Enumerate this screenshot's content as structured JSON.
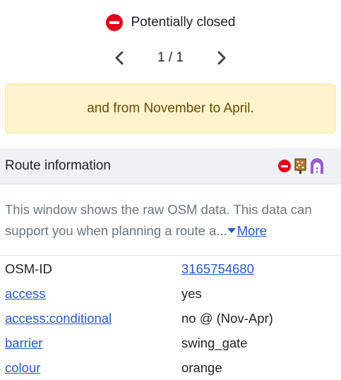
{
  "status": {
    "label": "Potentially closed",
    "icon": "no-entry-icon"
  },
  "pager": {
    "text": "1 / 1"
  },
  "alert": {
    "text": "and from November to April."
  },
  "route_section": {
    "title": "Route information",
    "icons": [
      "no-entry-icon",
      "swing-gate-icon",
      "tunnel-icon"
    ]
  },
  "description": {
    "text": "This window shows the raw OSM data. This data can support you when planning a route a...",
    "more_label": "More"
  },
  "tags": [
    {
      "key": "OSM-ID",
      "value": "3165754680"
    },
    {
      "key": "access",
      "value": "yes"
    },
    {
      "key": "access:conditional",
      "value": "no @ (Nov-Apr)"
    },
    {
      "key": "barrier",
      "value": "swing_gate"
    },
    {
      "key": "colour",
      "value": "orange"
    }
  ],
  "colors": {
    "link": "#2b59c3",
    "alert_bg": "#fff3cd",
    "no_entry_red": "#e4001b",
    "header_bg": "#f0f1f4"
  }
}
